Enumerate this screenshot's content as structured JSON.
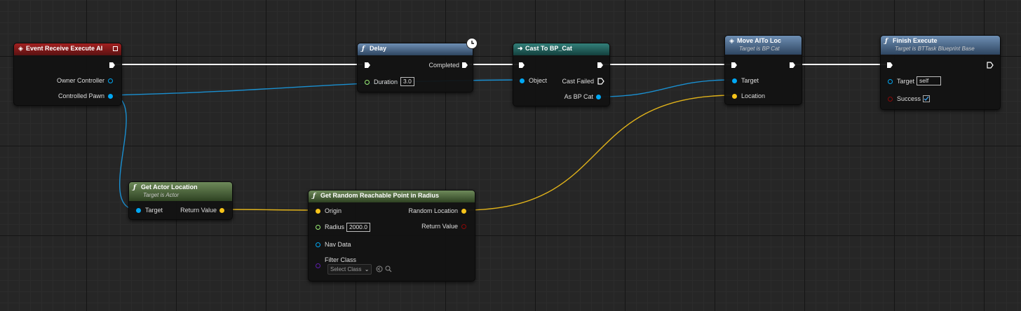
{
  "colors": {
    "exec": "#ffffff",
    "object": "#00a8f4",
    "vector": "#f7c41a",
    "float": "#9cf076",
    "bool": "#8a0808",
    "class": "#5b1ea8"
  },
  "nodes": {
    "event": {
      "title": "Event Receive Execute AI",
      "pins": {
        "owner": "Owner Controller",
        "pawn": "Controlled Pawn"
      }
    },
    "delay": {
      "title": "Delay",
      "pins": {
        "completed": "Completed",
        "duration": "Duration"
      },
      "duration_value": "3.0"
    },
    "cast": {
      "title": "Cast To BP_Cat",
      "pins": {
        "object": "Object",
        "failed": "Cast Failed",
        "as": "As BP Cat"
      }
    },
    "move": {
      "title": "Move AITo Loc",
      "subtitle": "Target is BP Cat",
      "pins": {
        "target": "Target",
        "location": "Location"
      }
    },
    "finish": {
      "title": "Finish Execute",
      "subtitle": "Target is BTTask Blueprint Base",
      "pins": {
        "target": "Target",
        "success": "Success"
      },
      "target_value": "self",
      "success_checked": true
    },
    "getloc": {
      "title": "Get Actor Location",
      "subtitle": "Target is Actor",
      "pins": {
        "target": "Target",
        "ret": "Return Value"
      }
    },
    "random": {
      "title": "Get Random Reachable Point in Radius",
      "pins": {
        "origin": "Origin",
        "radius": "Radius",
        "navdata": "Nav Data",
        "filter": "Filter Class",
        "randloc": "Random Location",
        "ret": "Return Value"
      },
      "radius_value": "2000.0",
      "filter_select": "Select Class"
    }
  }
}
